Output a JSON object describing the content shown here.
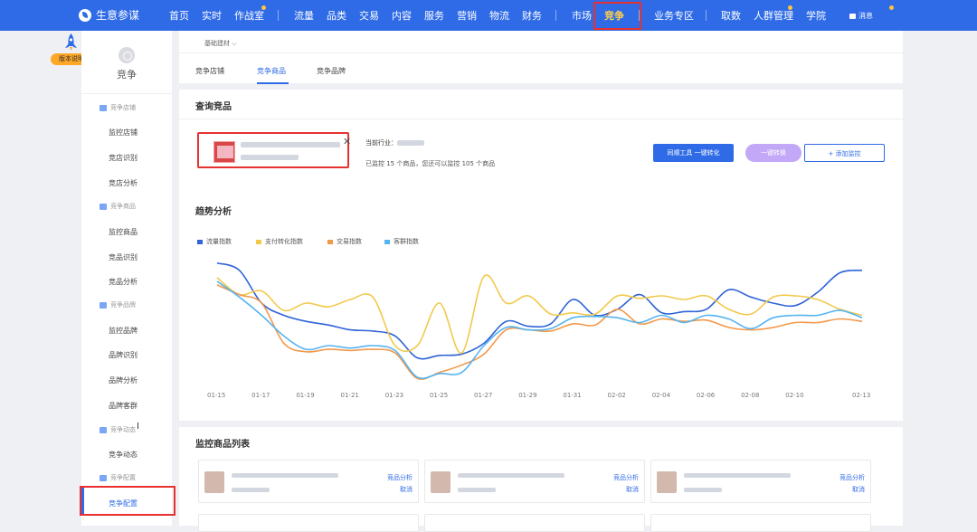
{
  "topnav": {
    "brand": "生意参谋",
    "items": [
      "首页",
      "实时",
      "作战室",
      "流量",
      "品类",
      "交易",
      "内容",
      "服务",
      "营销",
      "物流",
      "财务",
      "市场",
      "竞争",
      "业务专区",
      "取数",
      "人群管理",
      "学院"
    ],
    "active": "竞争",
    "message": "消息"
  },
  "version_badge": "版本说明",
  "sidebar": {
    "title": "竞争",
    "groups": [
      {
        "label": "竞争店铺",
        "items": [
          "监控店铺",
          "竞店识别",
          "竞店分析"
        ]
      },
      {
        "label": "竞争商品",
        "items": [
          "监控商品",
          "竞品识别",
          "竞品分析"
        ]
      },
      {
        "label": "竞争品牌",
        "items": [
          "监控品牌",
          "品牌识别",
          "品牌分析",
          "品牌客群"
        ]
      },
      {
        "label": "竞争动态",
        "items": [
          "竞争动态"
        ]
      },
      {
        "label": "竞争配置",
        "items": [
          "竞争配置"
        ]
      }
    ],
    "active": "竞争配置"
  },
  "tabs": {
    "category": "基础建材",
    "items": [
      "竞争店铺",
      "竞争商品",
      "竞争品牌"
    ],
    "active": "竞争商品"
  },
  "query": {
    "title": "查询竞品",
    "industry_label": "当前行业：",
    "monitor_info": "已监控 15 个商品，您还可以监控 105 个商品",
    "buttons": {
      "convert": "同顺工具 一键转化",
      "one_click": "一键转换",
      "add_monitor": "+ 添加监控"
    }
  },
  "trend": {
    "title": "趋势分析"
  },
  "chart_data": {
    "type": "line",
    "x": [
      "01-15",
      "01-16",
      "01-17",
      "01-18",
      "01-19",
      "01-20",
      "01-21",
      "01-22",
      "01-23",
      "01-24",
      "01-25",
      "01-26",
      "01-27",
      "01-28",
      "01-29",
      "01-30",
      "01-31",
      "02-01",
      "02-02",
      "02-03",
      "02-04",
      "02-05",
      "02-06",
      "02-07",
      "02-08",
      "02-09",
      "02-10",
      "02-11",
      "02-12",
      "02-13"
    ],
    "xticks": [
      "01-15",
      "01-17",
      "01-19",
      "01-21",
      "01-23",
      "01-25",
      "01-27",
      "01-29",
      "01-31",
      "02-02",
      "02-04",
      "02-06",
      "02-08",
      "02-10",
      "02-13"
    ],
    "series": [
      {
        "name": "流量指数",
        "color": "#2f63d6",
        "values": [
          88,
          82,
          55,
          45,
          40,
          37,
          33,
          32,
          28,
          10,
          12,
          13,
          22,
          40,
          36,
          38,
          58,
          45,
          50,
          62,
          47,
          48,
          50,
          66,
          60,
          55,
          53,
          64,
          80,
          82
        ]
      },
      {
        "name": "支付转化指数",
        "color": "#f2c94c",
        "values": [
          76,
          62,
          65,
          49,
          55,
          52,
          58,
          60,
          20,
          20,
          55,
          14,
          77,
          55,
          61,
          46,
          47,
          46,
          61,
          59,
          61,
          58,
          61,
          50,
          46,
          60,
          61,
          58,
          50,
          45
        ]
      },
      {
        "name": "交易指数",
        "color": "#f2994a",
        "values": [
          70,
          62,
          55,
          22,
          15,
          17,
          16,
          17,
          14,
          -7,
          -2,
          4,
          13,
          33,
          33,
          32,
          38,
          37,
          50,
          38,
          42,
          40,
          41,
          35,
          33,
          35,
          39,
          39,
          42,
          40
        ]
      },
      {
        "name": "客群指数",
        "color": "#56b4f0",
        "values": [
          73,
          60,
          45,
          28,
          17,
          20,
          18,
          20,
          16,
          -6,
          -3,
          -2,
          20,
          35,
          33,
          34,
          43,
          44,
          43,
          39,
          45,
          39,
          45,
          42,
          34,
          43,
          45,
          45,
          49,
          43
        ]
      }
    ],
    "ylim": [
      -12,
      96
    ],
    "grid": false,
    "legend": "top-left"
  },
  "list": {
    "title": "监控商品列表",
    "item_links": {
      "analysis": "竞品分析",
      "cancel": "取消"
    }
  }
}
